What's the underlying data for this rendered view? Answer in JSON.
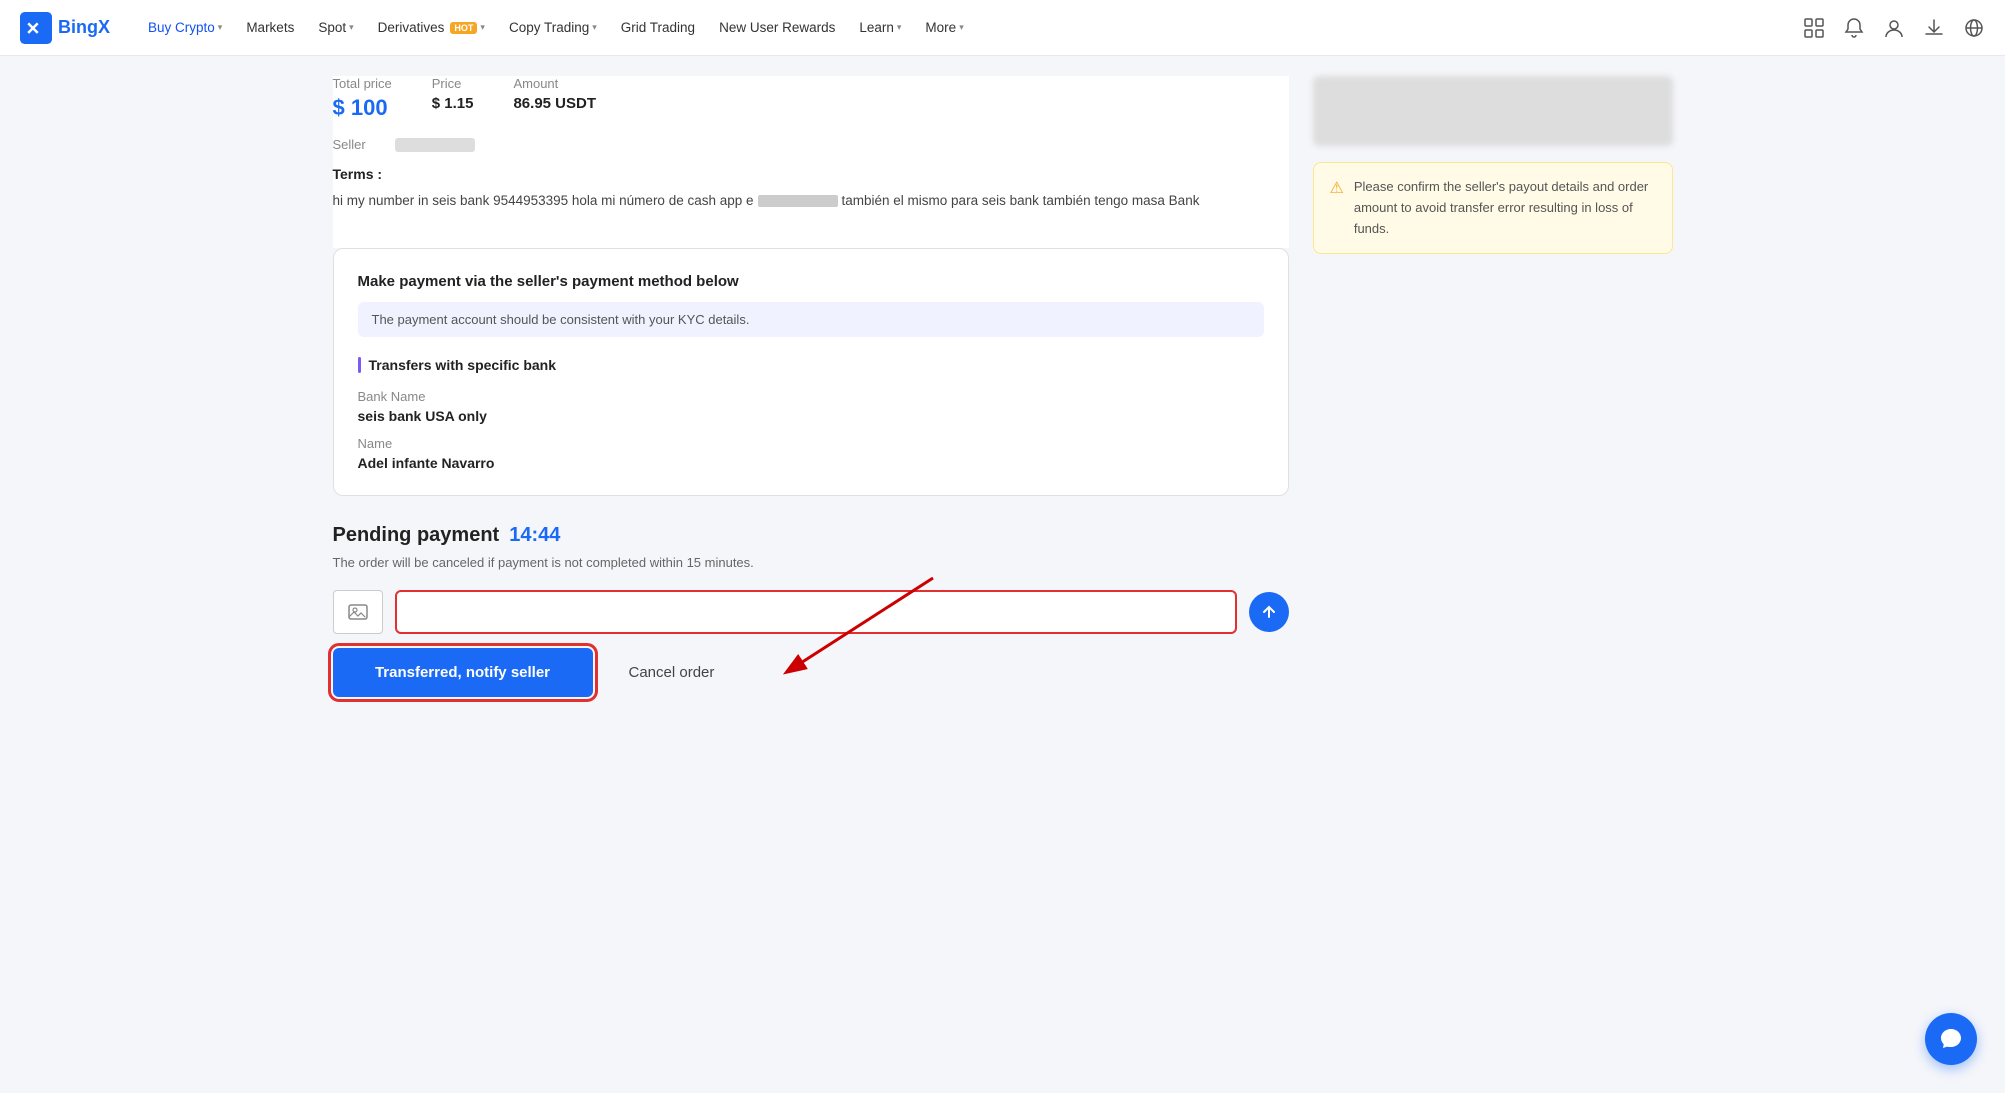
{
  "nav": {
    "logo_text": "BingX",
    "items": [
      {
        "label": "Buy Crypto",
        "active": true,
        "has_dropdown": true,
        "hot": false
      },
      {
        "label": "Markets",
        "active": false,
        "has_dropdown": false,
        "hot": false
      },
      {
        "label": "Spot",
        "active": false,
        "has_dropdown": true,
        "hot": false
      },
      {
        "label": "Derivatives",
        "active": false,
        "has_dropdown": true,
        "hot": true
      },
      {
        "label": "Copy Trading",
        "active": false,
        "has_dropdown": true,
        "hot": false
      },
      {
        "label": "Grid Trading",
        "active": false,
        "has_dropdown": false,
        "hot": false
      },
      {
        "label": "New User Rewards",
        "active": false,
        "has_dropdown": false,
        "hot": false
      },
      {
        "label": "Learn",
        "active": false,
        "has_dropdown": true,
        "hot": false
      },
      {
        "label": "More",
        "active": false,
        "has_dropdown": true,
        "hot": false
      }
    ]
  },
  "order": {
    "total_price_label": "Total price",
    "total_price_value": "$ 100",
    "price_label": "Price",
    "price_value": "$ 1.15",
    "amount_label": "Amount",
    "amount_value": "86.95 USDT",
    "seller_label": "Seller",
    "terms_label": "Terms :",
    "terms_text_1": "hi my number in seis bank 9544953395 hola mi número de cash app e",
    "terms_text_2": "también el mismo para seis bank también tengo masa Bank"
  },
  "payment": {
    "card_title": "Make payment via the seller's payment method below",
    "kyc_notice": "The payment account should be consistent with your KYC details.",
    "method_title": "Transfers with specific bank",
    "bank_name_label": "Bank Name",
    "bank_name_value": "seis bank USA only",
    "name_label": "Name",
    "name_value": "Adel infante Navarro"
  },
  "pending": {
    "title": "Pending payment",
    "timer": "14:44",
    "note": "The order will be canceled if payment is not completed within 15 minutes.",
    "notify_btn": "Transferred, notify seller",
    "cancel_btn": "Cancel order"
  },
  "message": {
    "placeholder": ""
  },
  "warning": {
    "text": "Please confirm the seller's payout details and order amount to avoid transfer error resulting in loss of funds."
  },
  "icons": {
    "logo": "✕",
    "chevron": "▾",
    "hot": "HOT",
    "notifications": "🔔",
    "user": "👤",
    "download": "⬇",
    "globe": "🌐",
    "portfolio": "⊟",
    "upload": "🖼",
    "send": "↑",
    "chat": "💬",
    "warning_dot": "●"
  }
}
